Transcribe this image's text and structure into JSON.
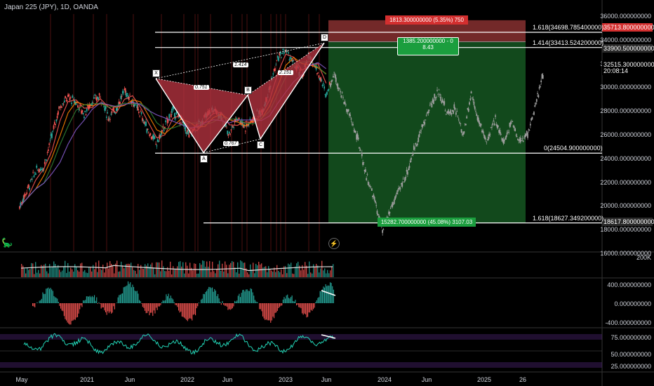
{
  "header": {
    "title": "Japan 225 (JPY), 1D, OANDA"
  },
  "colors": {
    "up": "#26a69a",
    "down": "#ef5350",
    "pattern_fill": "#b2323f",
    "stop_zone": "#d14b4b",
    "target_zone": "#1e7a2e",
    "osc_line": "#22d3b5",
    "osc_band": "#5b2a8a"
  },
  "chart_data": [
    {
      "type": "line",
      "pane": "price",
      "title": "Japan 225 (JPY), 1D, OANDA",
      "y_ticks": [
        "36000.000000000",
        "34000.000000000",
        "32000.000000000",
        "30000.000000000",
        "28000.000000000",
        "26000.000000000",
        "24000.000000000",
        "22000.000000000",
        "20000.000000000",
        "18000.000000000",
        "16000.000000000"
      ],
      "ylim": [
        16000,
        36000
      ],
      "x_ticks": [
        "May",
        "2021",
        "Jun",
        "2022",
        "Jun",
        "2023",
        "Jun",
        "2024",
        "Jun",
        "2025",
        "26"
      ],
      "price_tags": [
        {
          "text": "35713.800000000",
          "bg": "#d32f2f"
        },
        {
          "text": "33900.500000000",
          "bg": "#2a2a2a"
        },
        {
          "text": "32515.300000000",
          "bg": "#000000"
        },
        {
          "text": "20:08:14",
          "bg": "#000000"
        },
        {
          "text": "18617.800000000",
          "bg": "#2a2a2a"
        }
      ],
      "series": [
        {
          "name": "Close",
          "values": [
            20000,
            21500,
            23000,
            23400,
            26000,
            28500,
            29200,
            28800,
            27800,
            28900,
            29300,
            27500,
            28300,
            29800,
            28900,
            27800,
            26300,
            25300,
            26800,
            28100,
            27300,
            26000,
            26800,
            27500,
            28200,
            27700,
            26100,
            27600,
            26700,
            27500,
            28000,
            30000,
            32500,
            33200,
            32000,
            31000,
            32800,
            31300,
            29500,
            31200,
            29300,
            27500,
            25500,
            22600,
            20600,
            17800,
            19800,
            21300,
            22800,
            25000,
            26800,
            28600,
            29800,
            27800,
            28300,
            26000,
            29600,
            27000,
            25400,
            27500,
            25300,
            27300,
            25400,
            26200,
            28500,
            31500
          ]
        }
      ],
      "fib_levels": [
        {
          "label": "1.618(34698.785400000)",
          "value": 34698.79
        },
        {
          "label": "1.414(33413.524200000)",
          "value": 33413.52
        },
        {
          "label": "0(24504.900000000)",
          "value": 24504.9
        },
        {
          "label": "1.618(18627.349200000)",
          "value": 18627.35
        }
      ],
      "harmonic_pattern": {
        "points": [
          "X",
          "A",
          "B",
          "C",
          "D"
        ],
        "values": [
          30800,
          24550,
          29400,
          25700,
          33800
        ],
        "ratios": [
          "0.751",
          "1.414",
          "0.767",
          "2.151"
        ]
      },
      "position": {
        "entry": 33900.5,
        "stop": 35713.8,
        "target": 18617.8,
        "stop_label": "1813.300000000 (5.35%) 750",
        "target_label": "15282.700000000 (45.08%) 3107.03",
        "pl_label_1": "1385.200000000 - 0",
        "pl_label_2": "8.43"
      }
    },
    {
      "type": "bar",
      "pane": "volume",
      "y_ticks": [
        "200K"
      ]
    },
    {
      "type": "bar",
      "pane": "macd",
      "y_ticks": [
        "400.000000000",
        "0.000000000",
        "-400.000000000"
      ],
      "ylim": [
        -500,
        500
      ]
    },
    {
      "type": "line",
      "pane": "rsi",
      "y_ticks": [
        "75.000000000",
        "50.000000000",
        "25.000000000"
      ],
      "ylim": [
        15,
        85
      ]
    }
  ]
}
